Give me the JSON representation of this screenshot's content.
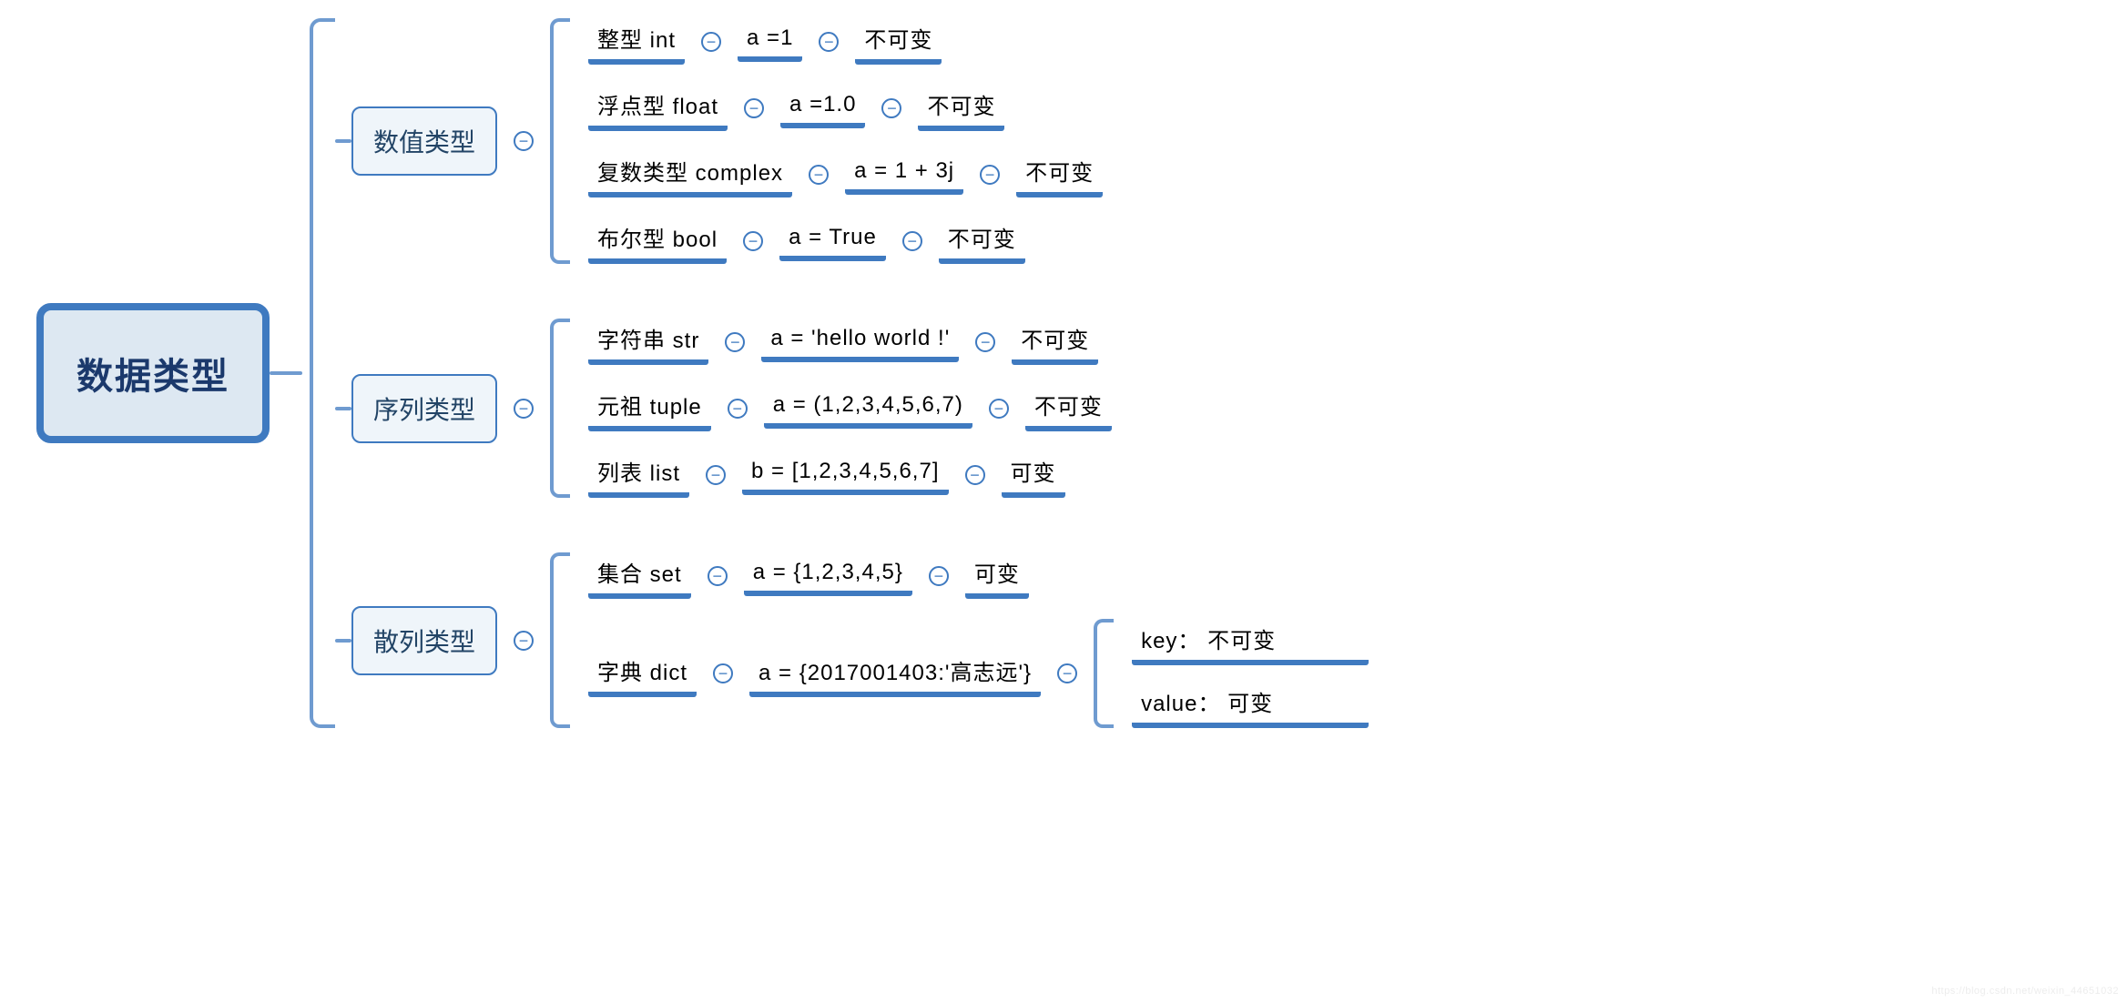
{
  "root": {
    "title": "数据类型"
  },
  "categories": [
    {
      "label": "数值类型",
      "leaves": [
        {
          "name": "整型  int",
          "example": "a =1",
          "mut": "不可变"
        },
        {
          "name": "浮点型  float",
          "example": "a =1.0",
          "mut": "不可变"
        },
        {
          "name": "复数类型  complex",
          "example": "a = 1 + 3j",
          "mut": "不可变"
        },
        {
          "name": "布尔型  bool",
          "example": "a = True",
          "mut": "不可变"
        }
      ]
    },
    {
      "label": "序列类型",
      "leaves": [
        {
          "name": "字符串  str",
          "example": "a = 'hello world !'",
          "mut": "不可变"
        },
        {
          "name": "元祖  tuple",
          "example": "a = (1,2,3,4,5,6,7)",
          "mut": "不可变"
        },
        {
          "name": "列表  list",
          "example": "b = [1,2,3,4,5,6,7]",
          "mut": "可变"
        }
      ]
    },
    {
      "label": "散列类型",
      "leaves": [
        {
          "name": "集合  set",
          "example": "a = {1,2,3,4,5}",
          "mut": "可变"
        },
        {
          "name": "字典  dict",
          "example": "a = {2017001403:'高志远'}",
          "children": [
            {
              "label": "key：",
              "mut": "不可变"
            },
            {
              "label": "value：",
              "mut": "可变"
            }
          ]
        }
      ]
    }
  ],
  "watermark": "https://blog.csdn.net/weixin_44651032"
}
